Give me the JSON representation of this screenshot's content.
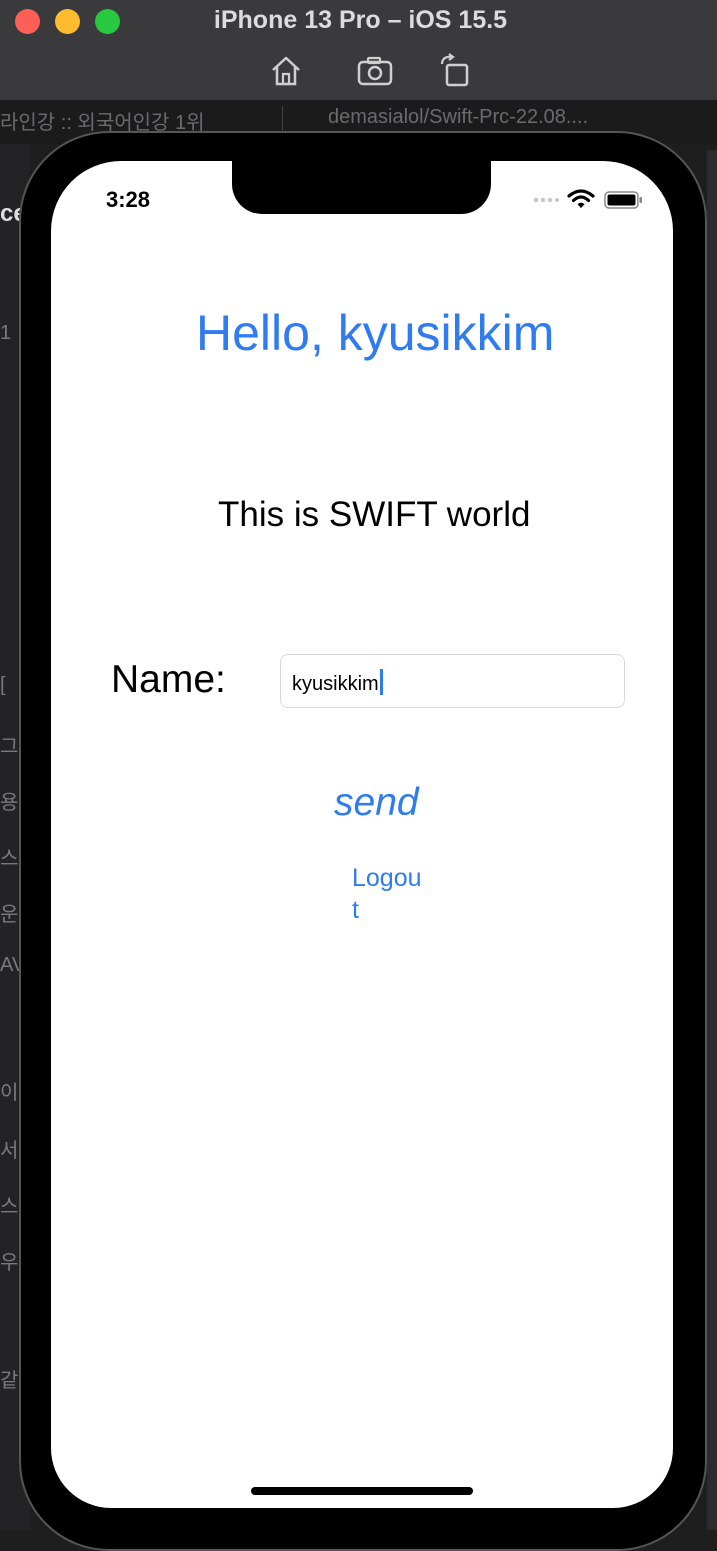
{
  "window": {
    "title": "iPhone 13 Pro – iOS 15.5"
  },
  "background": {
    "tab_left": "라인강 :: 외국어인강 1위",
    "tab_right": "demasialol/Swift-Prc-22.08....",
    "edge_letters": [
      "ce",
      "1",
      "[",
      "그",
      "용",
      "스",
      "운",
      "AV",
      "이",
      "서",
      "스",
      "우",
      "같"
    ]
  },
  "status_bar": {
    "time": "3:28"
  },
  "app": {
    "greeting": "Hello, kyusikkim",
    "subtitle": "This is SWIFT world",
    "name_label": "Name:",
    "name_value": "kyusikkim",
    "send_label": "send",
    "logout_label": "Logout"
  },
  "colors": {
    "accent": "#2f7bf0",
    "window_bar": "#3a3a3c"
  }
}
